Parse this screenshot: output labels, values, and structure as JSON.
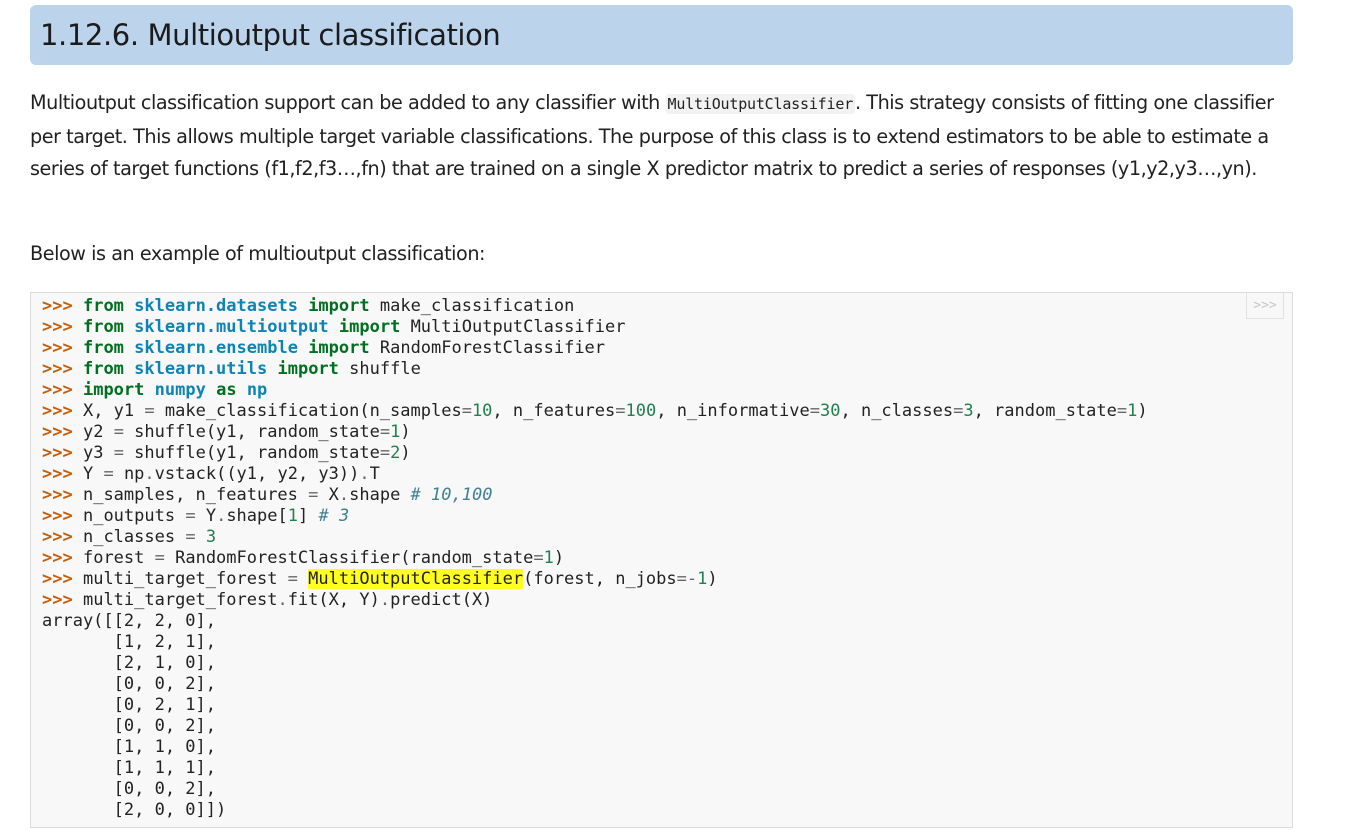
{
  "heading": "1.12.6. Multioutput classification",
  "paragraph": {
    "before": "Multioutput classification support can be added to any classifier with ",
    "code": "MultiOutputClassifier",
    "after": ". This strategy consists of fitting one classifier per target. This allows multiple target variable classifications. The purpose of this class is to extend estimators to be able to estimate a series of target functions (f1,f2,f3…,fn) that are trained on a single X predictor matrix to predict a series of responses (y1,y2,y3…,yn)."
  },
  "below_text": "Below is an example of multioutput classification:",
  "copy_button_label": ">>>",
  "prompt": ">>>",
  "code": {
    "from": "from",
    "import": "import",
    "as": "as",
    "mod_datasets": "sklearn.datasets",
    "mod_multioutput": "sklearn.multioutput",
    "mod_ensemble": "sklearn.ensemble",
    "mod_utils": "sklearn.utils",
    "mod_numpy": "numpy",
    "alias_np": "np",
    "name_make_classification": "make_classification",
    "name_moc": "MultiOutputClassifier",
    "name_rfc": "RandomForestClassifier",
    "name_shuffle": "shuffle",
    "l6": {
      "a": "X, y1 ",
      "b": " make_classification(n_samples",
      "n1": "10",
      "c": ", n_features",
      "n2": "100",
      "d": ", n_informative",
      "n3": "30",
      "e": ", n_classes",
      "n4": "3",
      "f": ", random_state",
      "n5": "1",
      "g": ")"
    },
    "l7": {
      "a": "y2 ",
      "b": " shuffle(y1, random_state",
      "n": "1",
      "c": ")"
    },
    "l8": {
      "a": "y3 ",
      "b": " shuffle(y1, random_state",
      "n": "2",
      "c": ")"
    },
    "l9": {
      "a": "Y ",
      "b": " np",
      "c": "vstack((y1, y2, y3))",
      "d": "T"
    },
    "l10": {
      "a": "n_samples, n_features ",
      "b": " X",
      "c": "shape ",
      "comment": "# 10,100"
    },
    "l11": {
      "a": "n_outputs ",
      "b": " Y",
      "c": "shape[",
      "n": "1",
      "d": "] ",
      "comment": "# 3"
    },
    "l12": {
      "a": "n_classes ",
      "n": "3"
    },
    "l13": {
      "a": "forest ",
      "b": " RandomForestClassifier(random_state",
      "n": "1",
      "c": ")"
    },
    "l14": {
      "a": "multi_target_forest ",
      "b": " ",
      "hl": "MultiOutputClassifier",
      "c": "(forest, n_jobs",
      "op": "=-",
      "n": "1",
      "d": ")"
    },
    "l15": {
      "a": "multi_target_forest",
      "b": "fit(X, Y)",
      "c": "predict(X)"
    },
    "output_lines": [
      "array([[2, 2, 0],",
      "       [1, 2, 1],",
      "       [2, 1, 0],",
      "       [0, 0, 2],",
      "       [0, 2, 1],",
      "       [0, 0, 2],",
      "       [1, 1, 0],",
      "       [1, 1, 1],",
      "       [0, 0, 2],",
      "       [2, 0, 0]])"
    ]
  }
}
